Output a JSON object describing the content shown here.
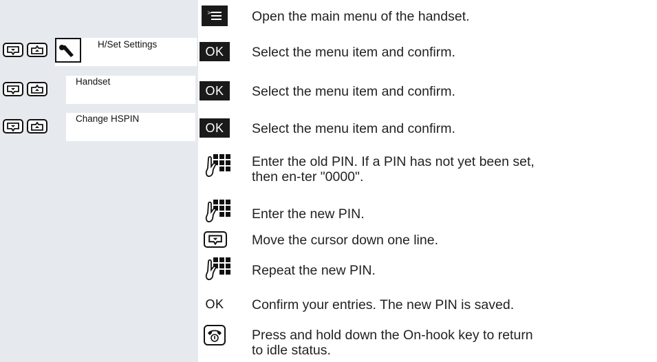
{
  "steps": [
    {
      "icon": "menu-key-icon",
      "text": "Open the main menu of the handset."
    },
    {
      "icon": "ok-key",
      "display": "H/Set Settings",
      "display_icon": "wrench-icon",
      "ok": "OK",
      "text": "Select the menu item and confirm."
    },
    {
      "icon": "ok-key",
      "display": "Handset",
      "ok": "OK",
      "text": "Select the menu item and confirm."
    },
    {
      "icon": "ok-key",
      "display": "Change HSPIN",
      "ok": "OK",
      "text": "Select the menu item and confirm."
    },
    {
      "icon": "keypad-icon",
      "text": "Enter the old PIN. If a PIN has not yet been set, then en-ter \"0000\"."
    },
    {
      "icon": "keypad-icon",
      "text": "Enter the new PIN."
    },
    {
      "icon": "control-key-down-icon",
      "text": "Move the cursor down one line."
    },
    {
      "icon": "keypad-icon",
      "text": "Repeat the new PIN."
    },
    {
      "icon": "ok-display-key",
      "ok": "OK",
      "text": "Confirm your entries. The new PIN is saved."
    },
    {
      "icon": "on-hook-key-icon",
      "text": "Press and hold down the On-hook key to return to idle status."
    }
  ],
  "colors": {
    "sidebar": "#e6e9ee",
    "key_fill": "#1a1a1a",
    "text": "#222222"
  }
}
